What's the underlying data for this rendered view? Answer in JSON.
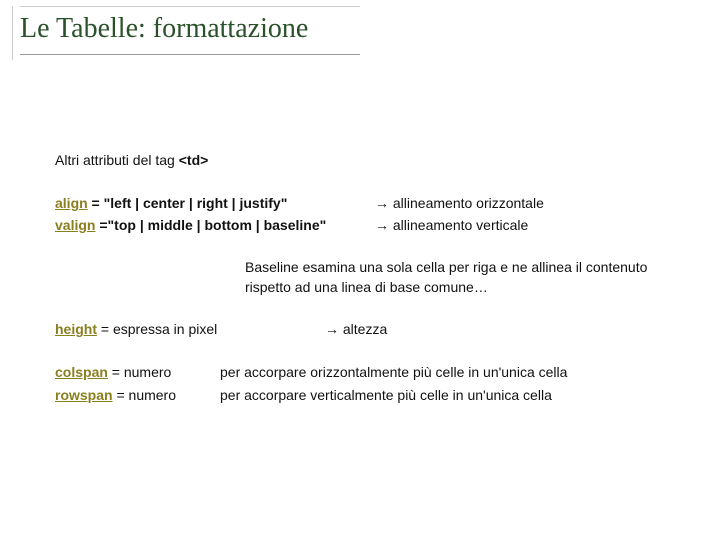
{
  "title": "Le Tabelle: formattazione",
  "intro_prefix": "Altri attributi del tag ",
  "intro_tag": "<td>",
  "attrs": {
    "align": {
      "name": "align",
      "eq": " = ",
      "values": "\"left | center | right | justify\"",
      "desc_arrow": "→",
      "desc": " allineamento orizzontale"
    },
    "valign": {
      "name": "valign",
      "eq": " =",
      "values": "\"top | middle | bottom | baseline\"",
      "desc_arrow": "→",
      "desc": " allineamento verticale"
    }
  },
  "baseline_note": "Baseline esamina una sola cella per riga e ne allinea il contenuto rispetto ad una linea di base comune…",
  "height": {
    "name": "height",
    "rest": " = espressa in pixel",
    "desc_arrow": "→",
    "desc": " altezza"
  },
  "colspan": {
    "name": "colspan",
    "rest": " = numero",
    "desc": "per accorpare orizzontalmente più celle in un'unica cella"
  },
  "rowspan": {
    "name": "rowspan",
    "rest": " = numero",
    "desc": " per accorpare verticalmente più celle in un'unica cella"
  }
}
